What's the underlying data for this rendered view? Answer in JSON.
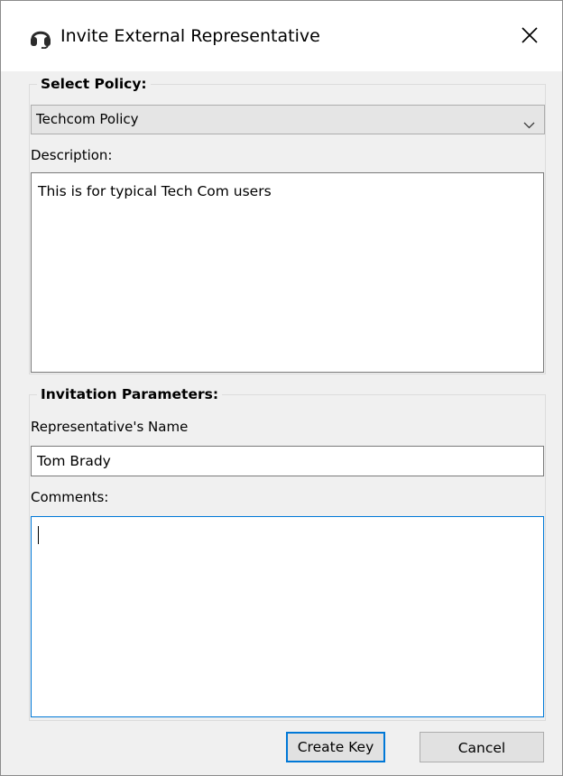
{
  "window": {
    "title": "Invite External Representative",
    "icon": "headset-icon",
    "close_icon": "close-icon"
  },
  "policy_group": {
    "legend": "Select Policy:",
    "selected_policy": "Techcom Policy",
    "description_label": "Description:",
    "description_value": "This is for typical Tech Com users"
  },
  "invitation_group": {
    "legend": "Invitation Parameters:",
    "rep_name_label": "Representative's Name",
    "rep_name_value": "Tom Brady",
    "comments_label": "Comments:",
    "comments_value": ""
  },
  "buttons": {
    "create_key": "Create Key",
    "cancel": "Cancel"
  },
  "colors": {
    "focus_accent": "#0078d7",
    "dialog_background": "#f0f0f0",
    "titlebar_background": "#ffffff"
  }
}
